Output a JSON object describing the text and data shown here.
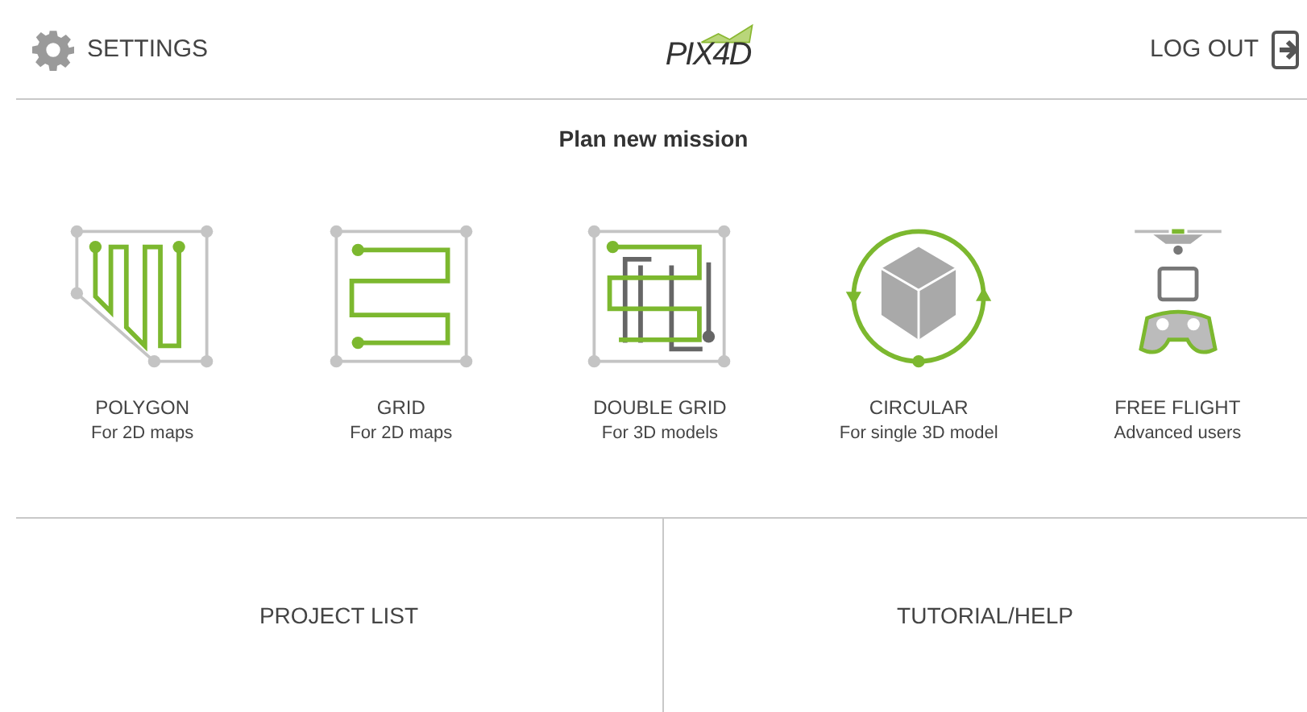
{
  "header": {
    "settings": "SETTINGS",
    "logo": "PIX4D",
    "logout": "LOG OUT"
  },
  "title": "Plan new mission",
  "missions": [
    {
      "kind": "polygon",
      "name": "POLYGON",
      "subtitle": "For 2D maps"
    },
    {
      "kind": "grid",
      "name": "GRID",
      "subtitle": "For 2D maps"
    },
    {
      "kind": "double_grid",
      "name": "DOUBLE GRID",
      "subtitle": "For 3D models"
    },
    {
      "kind": "circular",
      "name": "CIRCULAR",
      "subtitle": "For single 3D model"
    },
    {
      "kind": "free_flight",
      "name": "FREE FLIGHT",
      "subtitle": "Advanced users"
    }
  ],
  "footer": [
    "PROJECT LIST",
    "TUTORIAL/HELP"
  ]
}
